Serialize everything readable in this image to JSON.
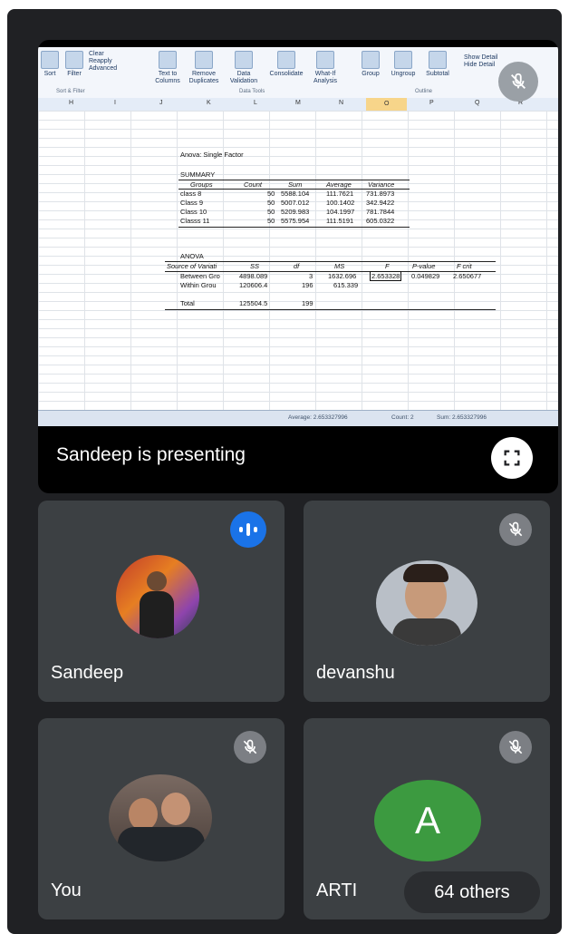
{
  "presentation": {
    "presenter_label": "Sandeep is presenting",
    "ribbon": {
      "buttons": [
        "Sort",
        "Filter",
        "Clear",
        "Reapply",
        "Advanced",
        "Text to Columns",
        "Remove Duplicates",
        "Data Validation",
        "Consolidate",
        "What-If Analysis",
        "Group",
        "Ungroup",
        "Subtotal",
        "Show Detail",
        "Hide Detail"
      ],
      "groups": [
        "Sort & Filter",
        "Data Tools",
        "Outline"
      ]
    },
    "columns": [
      "H",
      "I",
      "J",
      "K",
      "L",
      "M",
      "N",
      "O",
      "P",
      "Q",
      "R"
    ],
    "anova": {
      "title": "Anova: Single Factor",
      "summary_label": "SUMMARY",
      "summary_headers": [
        "Groups",
        "Count",
        "Sum",
        "Average",
        "Variance"
      ],
      "summary_rows": [
        [
          "class 8",
          "50",
          "5588.104",
          "111.7621",
          "731.8973"
        ],
        [
          "Class 9",
          "50",
          "5007.012",
          "100.1402",
          "342.9422"
        ],
        [
          "Class 10",
          "50",
          "5209.983",
          "104.1997",
          "781.7844"
        ],
        [
          "Classs 11",
          "50",
          "5575.954",
          "111.5191",
          "605.0322"
        ]
      ],
      "anova_label": "ANOVA",
      "anova_headers": [
        "Source of Variati",
        "SS",
        "df",
        "MS",
        "F",
        "P-value",
        "F crit"
      ],
      "anova_rows": [
        [
          "Between Gro",
          "4898.089",
          "3",
          "1632.696",
          "2.653328",
          "0.049829",
          "2.650677"
        ],
        [
          "Within Grou",
          "120606.4",
          "196",
          "615.339",
          "",
          "",
          ""
        ],
        [
          "",
          "",
          "",
          "",
          "",
          "",
          ""
        ],
        [
          "Total",
          "125504.5",
          "199",
          "",
          "",
          "",
          ""
        ]
      ]
    },
    "status": {
      "average": "Average: 2.653327996",
      "count": "Count: 2",
      "sum": "Sum: 2.653327996"
    }
  },
  "participants": [
    {
      "name": "Sandeep",
      "speaking": true
    },
    {
      "name": "devanshu",
      "muted": true
    },
    {
      "name": "You",
      "muted": true
    },
    {
      "name": "ARTI",
      "initial": "A",
      "muted": true
    }
  ],
  "others_label": "64 others",
  "colors": {
    "background": "#202124",
    "tile": "#3c4043",
    "speaking": "#1a73e8",
    "avatar_green": "#3c9a40"
  }
}
